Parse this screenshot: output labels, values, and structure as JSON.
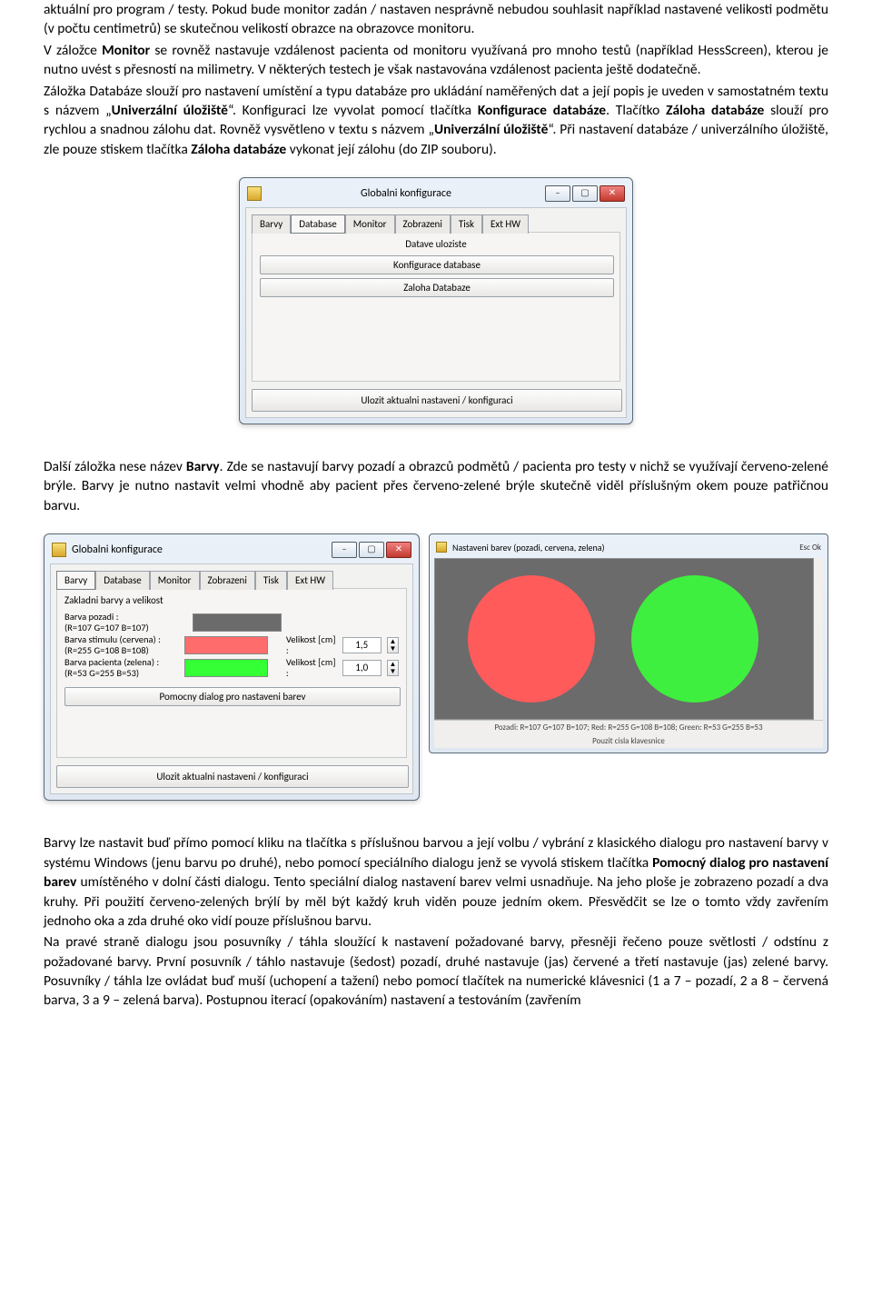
{
  "para1": "aktuální pro program / testy. Pokud bude monitor zadán / nastaven nesprávně nebudou souhlasit například nastavené velikosti podmětu (v počtu centimetrů) se skutečnou velikostí obrazce na obrazovce monitoru.",
  "para2a": "V záložce ",
  "para2b": "Monitor",
  "para2c": " se rovněž nastavuje vzdálenost pacienta od monitoru využívaná pro mnoho testů (například HessScreen), kterou je nutno uvést s přesností na milimetry. V některých testech je však nastavována vzdálenost pacienta ještě dodatečně.",
  "para3a": "Záložka Databáze slouží pro nastavení umístění a typu databáze pro ukládání naměřených dat a její popis je uveden v samostatném textu s názvem „",
  "para3b": "Univerzální úložiště",
  "para3c": "“. Konfiguraci lze vyvolat pomocí tlačítka ",
  "para3d": "Konfigurace databáze",
  "para3e": ". Tlačítko ",
  "para3f": "Záloha databáze",
  "para3g": " slouží pro rychlou a snadnou zálohu dat. Rovněž vysvětleno v textu s názvem „",
  "para3h": "Univerzální úložiště",
  "para3i": "“. Při nastavení databáze / univerzálního úložiště, zle pouze stiskem tlačítka ",
  "para3j": "Záloha databáze",
  "para3k": " vykonat její zálohu (do ZIP souboru).",
  "para4a": "Další záložka nese název ",
  "para4b": "Barvy",
  "para4c": ". Zde se nastavují barvy pozadí a obrazců podmětů / pacienta pro testy v nichž se využívají červeno-zelené brýle. Barvy je nutno nastavit velmi vhodně aby pacient přes červeno-zelené brýle skutečně viděl příslušným okem pouze patřičnou barvu.",
  "para5a": "Barvy lze nastavit buď přímo pomocí kliku na tlačítka s příslušnou barvou a její volbu / vybrání z klasického dialogu pro nastavení barvy v systému Windows (jenu barvu po druhé), nebo pomocí speciálního dialogu jenž se vyvolá stiskem tlačítka ",
  "para5b": "Pomocný dialog pro nastavení barev",
  "para5c": " umístěného v dolní části dialogu. Tento speciální dialog nastavení barev velmi usnadňuje. Na jeho ploše je zobrazeno pozadí a dva kruhy. Při použití červeno-zelených brýlí by měl být každý kruh viděn pouze jedním okem. Přesvědčit se lze o tomto vždy zavřením jednoho oka a zda druhé oko vidí pouze příslušnou barvu.",
  "para6": "Na pravé straně dialogu jsou posuvníky / táhla sloužící k nastavení požadované barvy, přesněji řečeno pouze světlosti / odstínu z požadované barvy. První posuvník / táhlo nastavuje (šedost) pozadí, druhé nastavuje (jas) červené a třetí nastavuje (jas) zelené barvy. Posuvníky / táhla lze ovládat buď muší (uchopení a tažení) nebo pomocí tlačítek na numerické klávesnici (1 a 7 – pozadí, 2 a 8 – červená barva, 3 a 9 – zelená barva). Postupnou iterací (opakováním) nastavení a testováním (zavřením",
  "dlg1": {
    "title": "Globalni konfigurace",
    "tabs": [
      "Barvy",
      "Database",
      "Monitor",
      "Zobrazeni",
      "Tisk",
      "Ext HW"
    ],
    "activeTab": "Database",
    "group": "Datave uloziste",
    "btn1": "Konfigurace database",
    "btn2": "Zaloha Databaze",
    "save": "Ulozit aktualni nastaveni / konfiguraci"
  },
  "dlg2": {
    "title": "Globalni konfigurace",
    "tabs": [
      "Barvy",
      "Database",
      "Monitor",
      "Zobrazeni",
      "Tisk",
      "Ext HW"
    ],
    "activeTab": "Barvy",
    "group": "Zakladni barvy a velikost",
    "row_bg_a": "Barva pozadi :",
    "row_bg_b": "(R=107 G=107 B=107)",
    "row_st_a": "Barva stimulu (cervena) :",
    "row_st_b": "(R=255 G=108 B=108)",
    "row_pa_a": "Barva pacienta (zelena) :",
    "row_pa_b": "(R=53 G=255 B=53)",
    "vlabelSt": "Velikost [cm] :",
    "vvalSt": "1,5",
    "vlabelPa": "Velikost [cm] :",
    "vvalPa": "1,0",
    "helper": "Pomocny dialog pro nastaveni barev",
    "save": "Ulozit aktualni nastaveni / konfiguraci"
  },
  "preview": {
    "title": "Nastaveni barev (pozadi, cervena, zelena)",
    "btns": "Esc  Ok",
    "status1": "Pozadi: R=107 G=107 B=107; Red: R=255 G=108 B=108; Green: R=53 G=255 B=53",
    "status2": "Pouzit cisla klavesnice"
  }
}
